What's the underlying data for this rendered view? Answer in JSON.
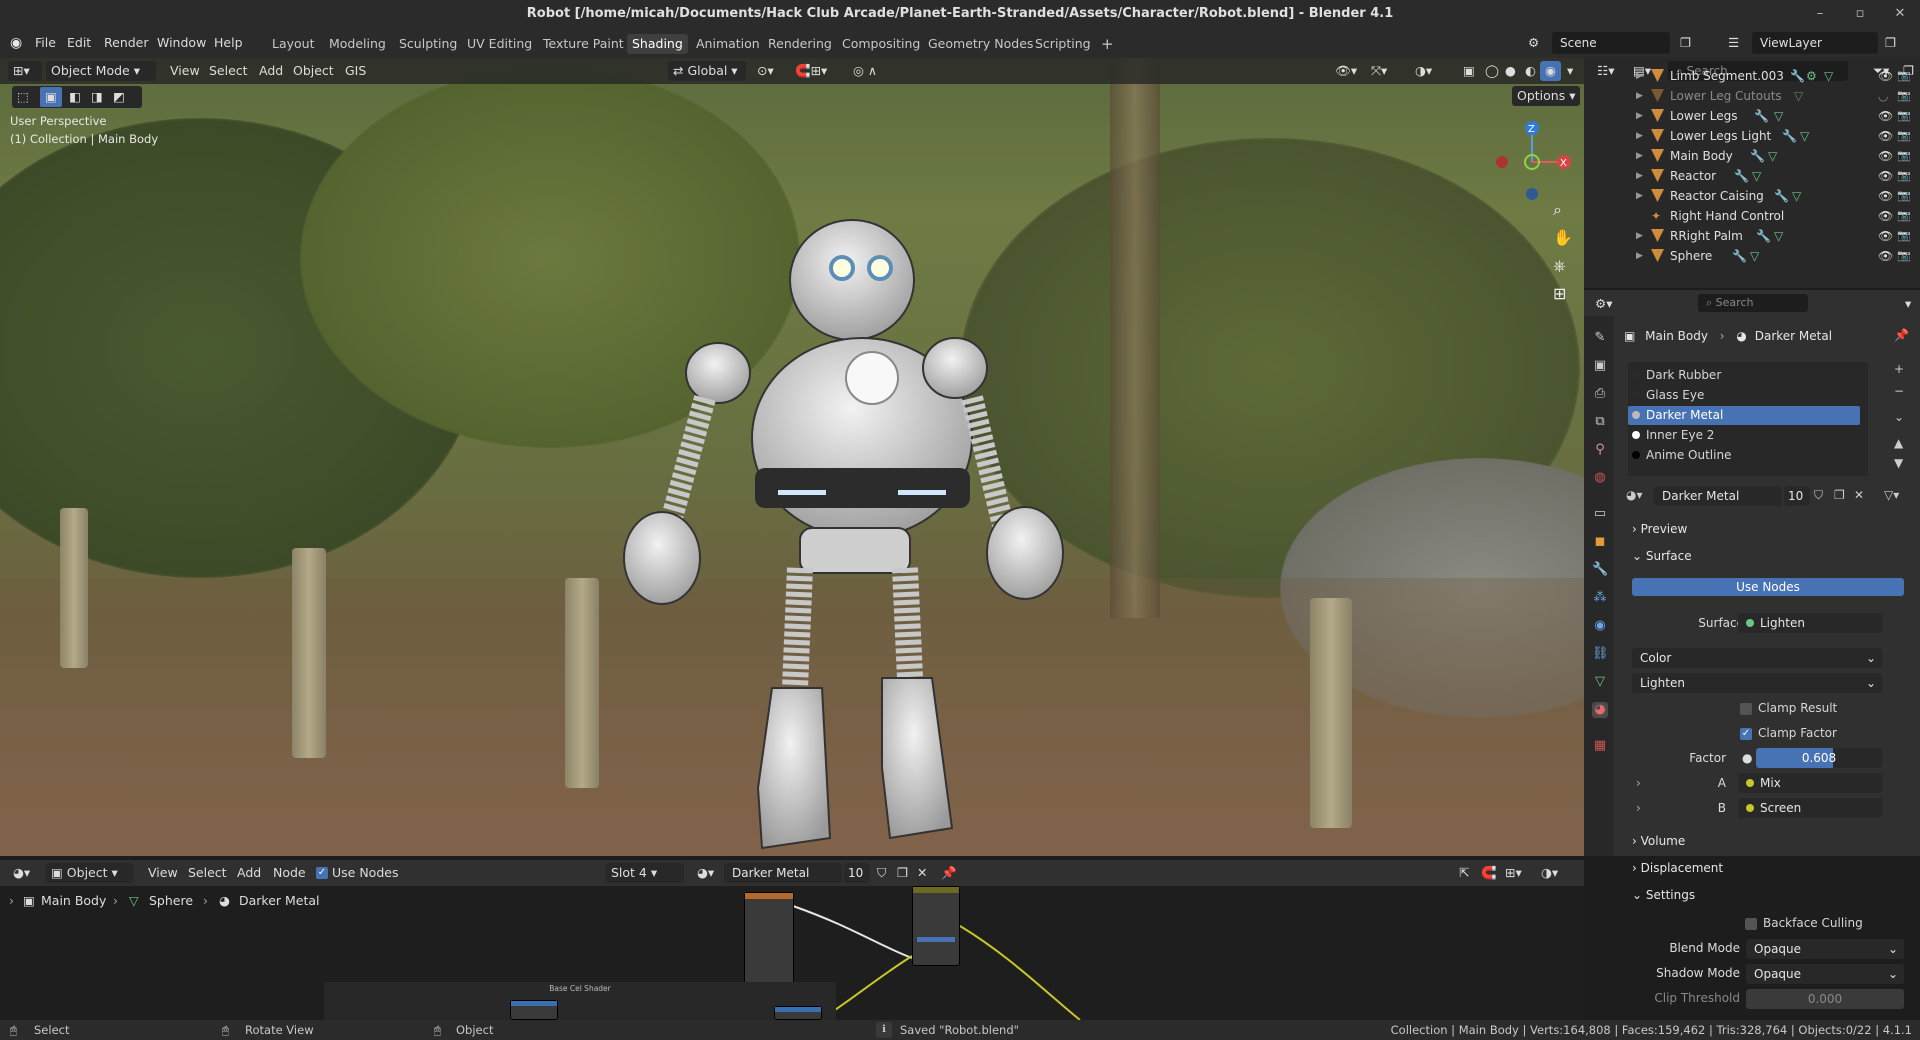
{
  "window": {
    "title": "Robot [/home/micah/Documents/Hack Club Arcade/Planet-Earth-Stranded/Assets/Character/Robot.blend] - Blender 4.1"
  },
  "menu": [
    "File",
    "Edit",
    "Render",
    "Window",
    "Help"
  ],
  "workspaces": [
    "Layout",
    "Modeling",
    "Sculpting",
    "UV Editing",
    "Texture Paint",
    "Shading",
    "Animation",
    "Rendering",
    "Compositing",
    "Geometry Nodes",
    "Scripting"
  ],
  "active_workspace": "Shading",
  "scene": "Scene",
  "view_layer": "ViewLayer",
  "viewport": {
    "mode": "Object Mode",
    "menu": [
      "View",
      "Select",
      "Add",
      "Object",
      "GIS"
    ],
    "transform_orientation": "Global",
    "options": "Options",
    "perspective": "User Perspective",
    "collection_info": "(1) Collection | Main Body",
    "gizmo": {
      "z": "Z",
      "x": "X"
    }
  },
  "outliner": {
    "search_placeholder": "Search",
    "items": [
      {
        "name": "Limb Segment.003",
        "visible": true
      },
      {
        "name": "Lower Leg Cutouts",
        "visible": false
      },
      {
        "name": "Lower Legs",
        "visible": true
      },
      {
        "name": "Lower Legs Light",
        "visible": true
      },
      {
        "name": "Main Body",
        "visible": true
      },
      {
        "name": "Reactor",
        "visible": true
      },
      {
        "name": "Reactor Caising",
        "visible": true
      },
      {
        "name": "Right Hand Control",
        "visible": true
      },
      {
        "name": "RRight Palm",
        "visible": true
      },
      {
        "name": "Sphere",
        "visible": true
      }
    ]
  },
  "properties": {
    "search_placeholder": "Search",
    "breadcrumb": {
      "object": "Main Body",
      "material": "Darker Metal"
    },
    "material_slots": [
      "Dark Rubber",
      "Glass Eye",
      "Darker Metal",
      "Inner Eye 2",
      "Anime Outline"
    ],
    "active_slot": "Darker Metal",
    "material_name": "Darker Metal",
    "users": "10",
    "sections": {
      "preview": "Preview",
      "surface": "Surface",
      "volume": "Volume",
      "displacement": "Displacement",
      "settings": "Settings"
    },
    "use_nodes": "Use Nodes",
    "surface_label": "Surface",
    "surface_value": "Lighten",
    "color_type": "Color",
    "blend_type": "Lighten",
    "clamp_result": "Clamp Result",
    "clamp_factor": "Clamp Factor",
    "factor_label": "Factor",
    "factor_value": "0.608",
    "factor_fraction": 0.608,
    "a_label": "A",
    "a_value": "Mix",
    "b_label": "B",
    "b_value": "Screen",
    "backface_culling": "Backface Culling",
    "blend_mode_label": "Blend Mode",
    "blend_mode": "Opaque",
    "shadow_mode_label": "Shadow Mode",
    "shadow_mode": "Opaque",
    "clip_threshold_label": "Clip Threshold",
    "clip_threshold": "0.000"
  },
  "node_editor": {
    "type": "Object",
    "menu": [
      "View",
      "Select",
      "Add",
      "Node"
    ],
    "use_nodes": "Use Nodes",
    "slot": "Slot 4",
    "material": "Darker Metal",
    "users": "10",
    "breadcrumb": [
      "Main Body",
      "Sphere",
      "Darker Metal"
    ],
    "frame_label": "Base Cel Shader"
  },
  "statusbar": {
    "select": "Select",
    "rotate": "Rotate View",
    "object": "Object",
    "message": "Saved \"Robot.blend\"",
    "stats": "Collection | Main Body | Verts:164,808 | Faces:159,462 | Tris:328,764 | Objects:0/22 | 4.1.1"
  },
  "colors": {
    "accent": "#4772b3",
    "object_orange": "#d08c3a",
    "socket_yellow": "#c7c729"
  }
}
